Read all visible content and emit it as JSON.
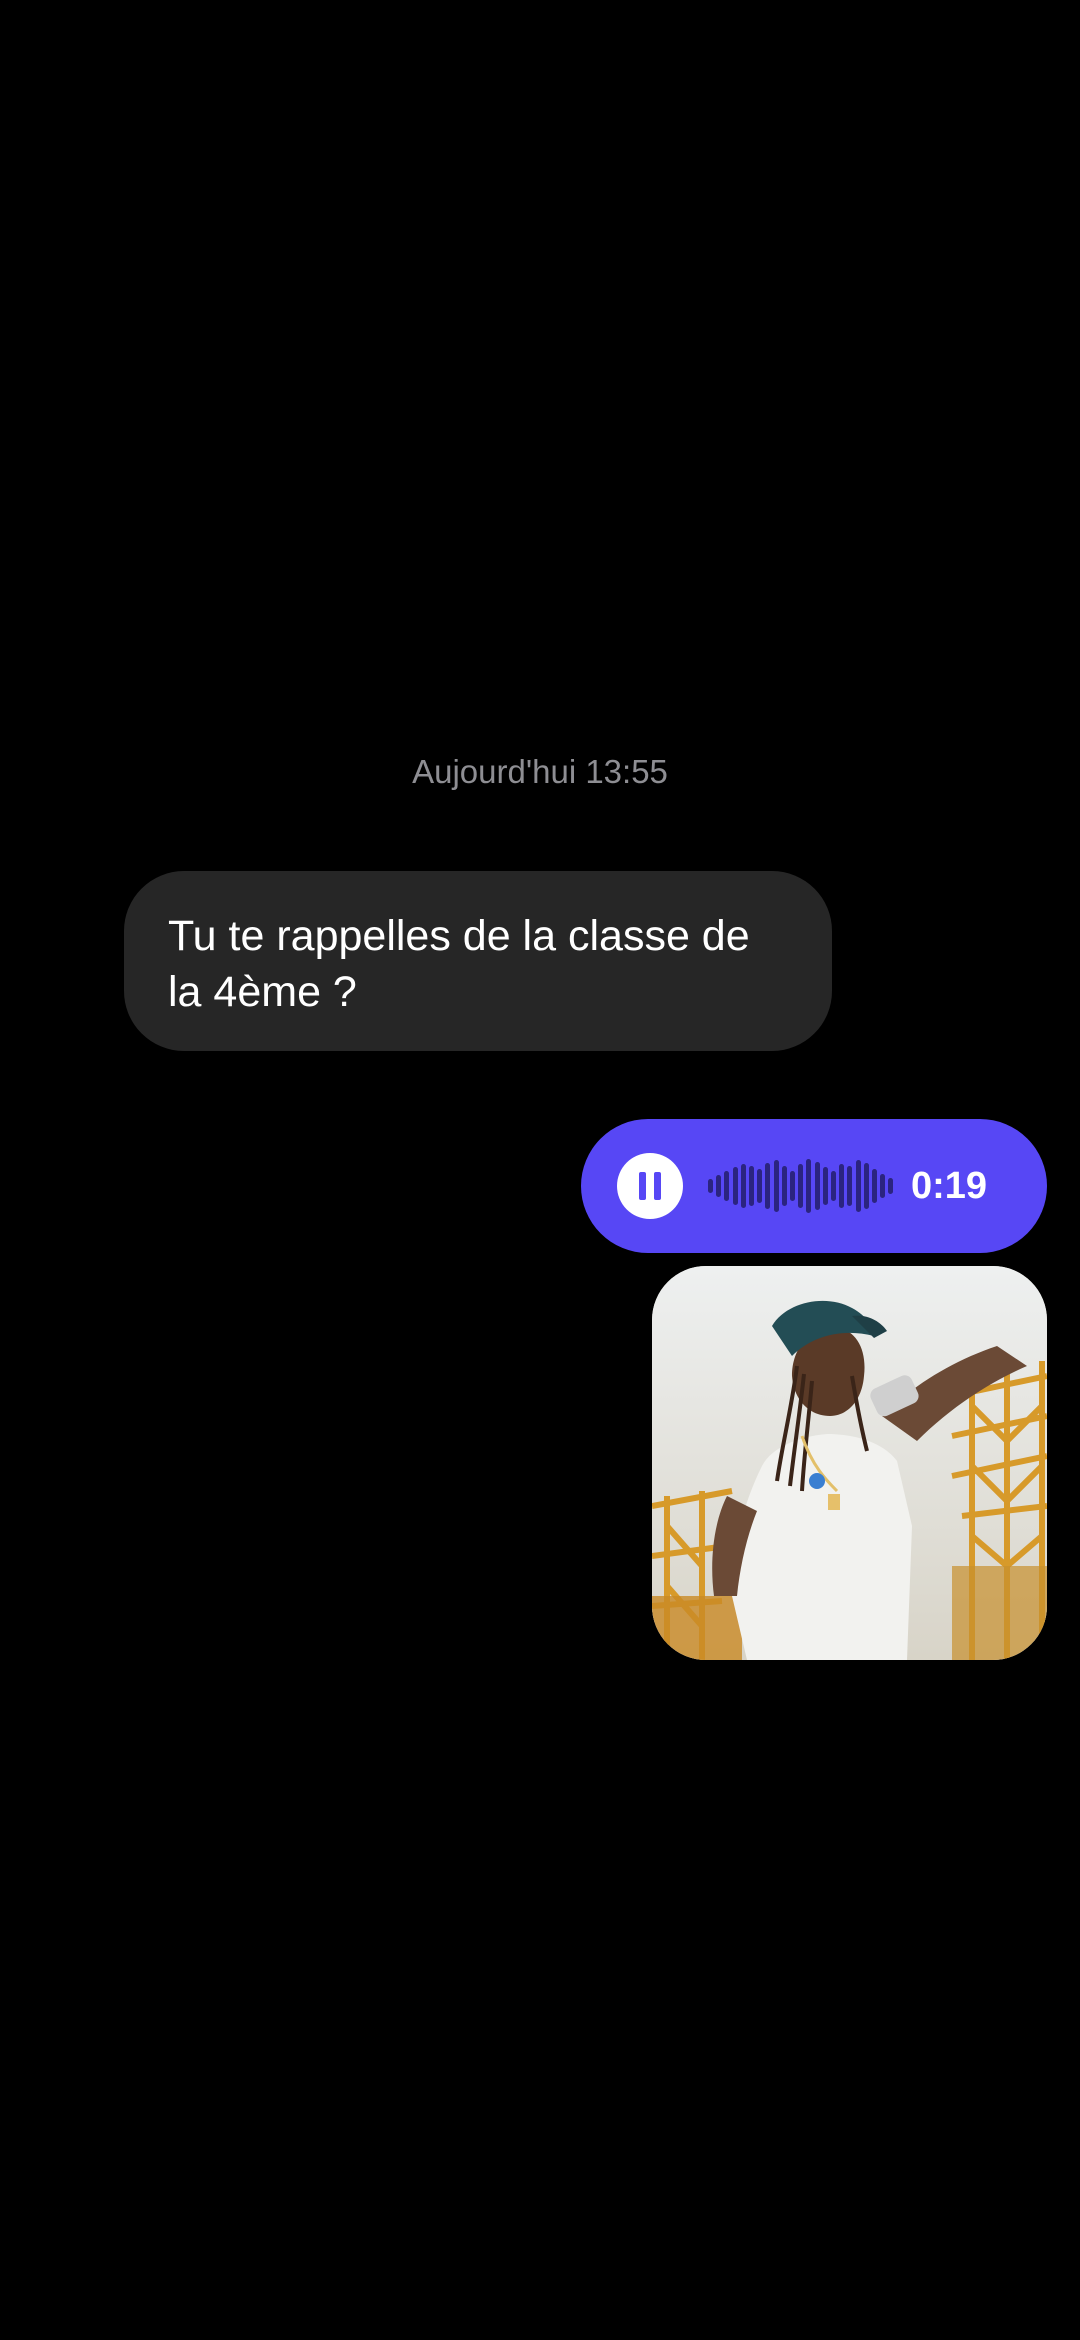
{
  "conversation": {
    "timestamp": "Aujourd'hui 13:55",
    "incoming_message": "Tu te rappelles de la classe de la 4ème ?",
    "voice_message": {
      "duration": "0:19",
      "state": "playing",
      "control_icon": "pause-icon"
    },
    "photo": {
      "description_icon": "photo-thumbnail"
    }
  },
  "colors": {
    "background": "#000000",
    "incoming_bubble": "#262626",
    "outgoing_accent": "#5747f5",
    "timestamp_text": "#8e8e93"
  }
}
